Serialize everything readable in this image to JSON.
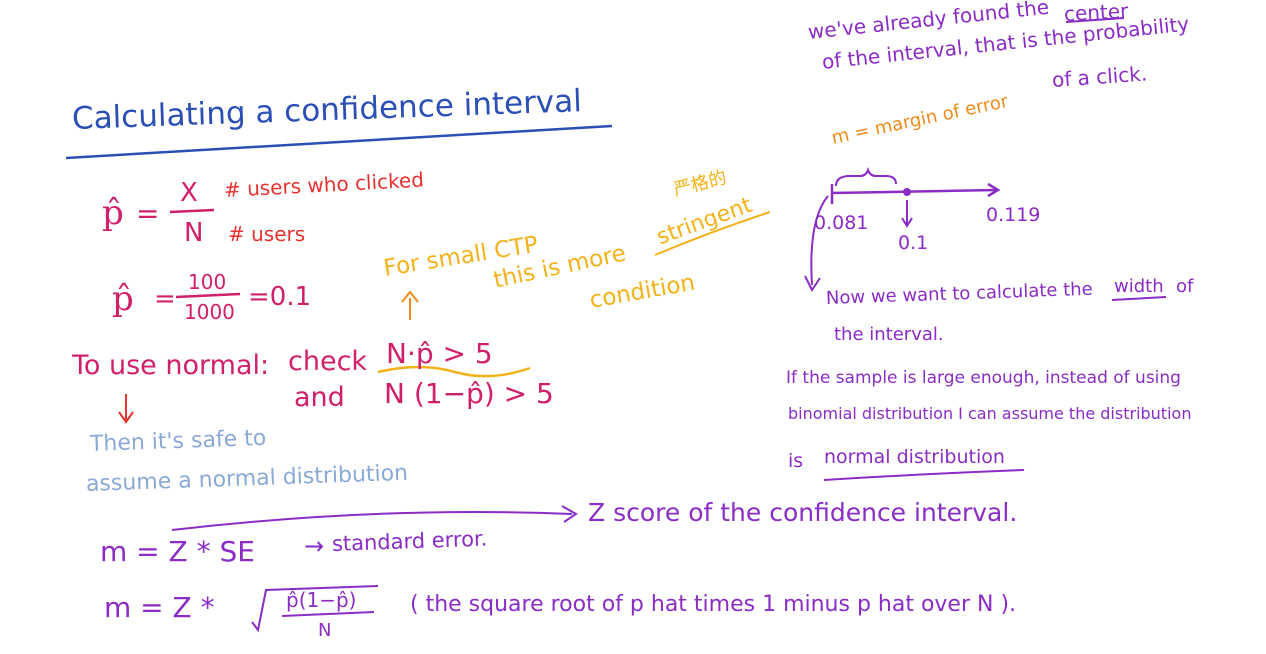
{
  "title": "Calculating a confidence interval",
  "colors": {
    "blue": "#2b4fb5",
    "red": "#e8322f",
    "magenta": "#d0206a",
    "purple": "#8a2cc6",
    "orange": "#f08a1c",
    "yellow": "#f2b21a",
    "lightblue": "#8aa9d6"
  },
  "phat_def": {
    "phat": "p̂",
    "eq": "=",
    "x": "X",
    "n": "N",
    "x_note": "# users who clicked",
    "n_note": "# users"
  },
  "phat_value": {
    "phat": "p̂",
    "eq": "=",
    "num": "100",
    "den": "1000",
    "result": "=0.1"
  },
  "normal_check": {
    "lead": "To use normal:",
    "check": "check",
    "and": "and",
    "cond1": "N·p̂ > 5",
    "cond2": "N (1−p̂) > 5",
    "arrow": "↓",
    "then1": "Then it's safe to",
    "then2": "assume a normal distribution"
  },
  "small_ctp": {
    "line1": "For small CTP",
    "line2": "this is more",
    "stringent": "stringent",
    "line3": "condition",
    "chinese": "严格的",
    "arrow": "↑"
  },
  "top_note": {
    "line1_a": "we've already found the",
    "line1_b": "center",
    "line2": "of the interval, that is the probability",
    "line3": "of a click."
  },
  "diagram": {
    "margin_label": "m = margin of error",
    "left": "0.081",
    "center": "0.1",
    "right": "0.119"
  },
  "width_note": {
    "line1_a": "Now we want to calculate the",
    "line1_b": "width",
    "line1_c": "of",
    "line2": "the interval."
  },
  "sample_note": {
    "line1": "If the sample is large enough, instead of using",
    "line2": "binomial distribution I can assume the distribution",
    "line3_a": "is",
    "line3_b": "normal distribution"
  },
  "formula1": {
    "lhs": "m = Z * SE",
    "arrow": "→",
    "note": "standard error.",
    "z_note": "Z score of the confidence interval."
  },
  "formula2": {
    "lhs": "m = Z *",
    "sqrt_num": "p̂(1−p̂)",
    "sqrt_den": "N",
    "note": "( the square root of p hat times 1 minus p hat over N )."
  }
}
